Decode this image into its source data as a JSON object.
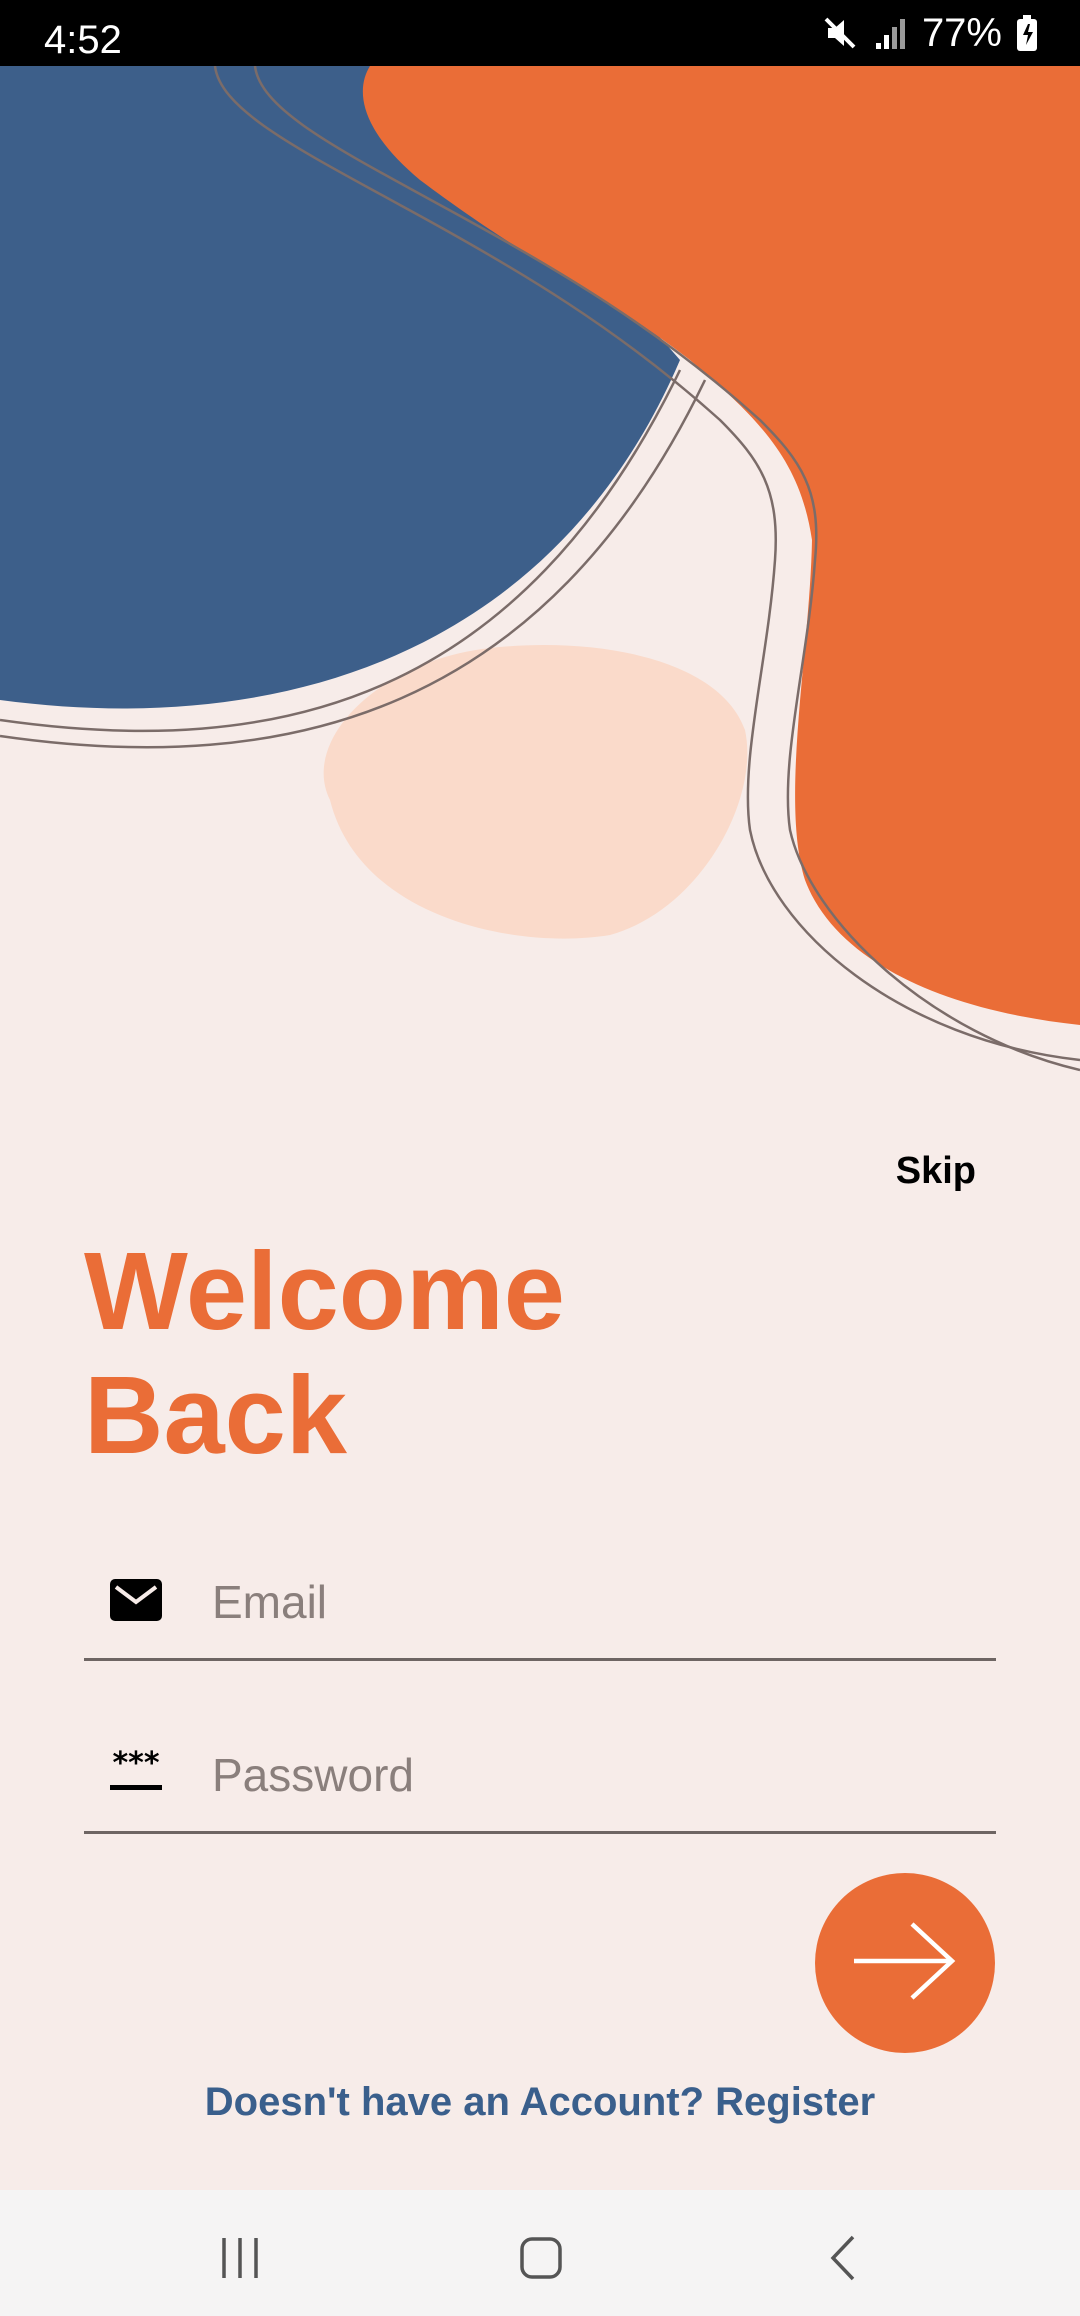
{
  "status_bar": {
    "time": "4:52",
    "battery": "77%",
    "icons": [
      "mute-icon",
      "signal-icon",
      "battery-charging-icon"
    ]
  },
  "login": {
    "skip_label": "Skip",
    "title_line1": "Welcome",
    "title_line2": "Back",
    "email_placeholder": "Email",
    "password_placeholder": "Password",
    "email_icon": "mail-icon",
    "password_icon": "password-icon",
    "submit_icon": "arrow-right-icon",
    "register_prompt": "Doesn't have an Account? Register"
  },
  "nav_bar": {
    "items": [
      "recent-apps-icon",
      "home-icon",
      "back-icon"
    ]
  },
  "colors": {
    "background": "#F7ECE9",
    "accent_orange": "#EA6D37",
    "accent_blue": "#3D5F8A",
    "peach": "#FADACA",
    "link_blue": "#3A5F8C"
  }
}
